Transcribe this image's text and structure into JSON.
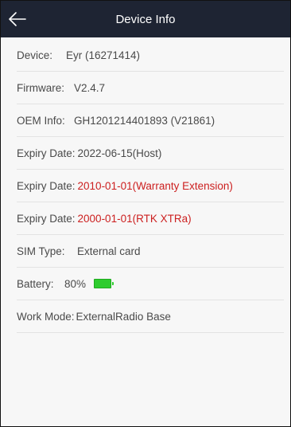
{
  "header": {
    "title": "Device Info",
    "back_icon": "arrow-left-icon"
  },
  "rows": [
    {
      "label": "Device:",
      "value": "Eyr (16271414)"
    },
    {
      "label": "Firmware:",
      "value": "V2.4.7"
    },
    {
      "label": "OEM Info:",
      "value": "GH1201214401893 (V21861)"
    },
    {
      "label": "Expiry Date:",
      "value": "2022-06-15(Host)"
    },
    {
      "label": "Expiry Date:",
      "value": "2010-01-01(Warranty Extension)"
    },
    {
      "label": "Expiry Date:",
      "value": "2000-01-01(RTK XTRa)"
    },
    {
      "label": "SIM Type:",
      "value": "External card"
    },
    {
      "label": "Battery:",
      "value": "80%"
    },
    {
      "label": "Work Mode:",
      "value": "ExternalRadio Base"
    }
  ],
  "battery_level": 0.8,
  "colors": {
    "header_bg": "#1e2433",
    "warning": "#cc1f1f",
    "battery": "#2ecc2e"
  }
}
